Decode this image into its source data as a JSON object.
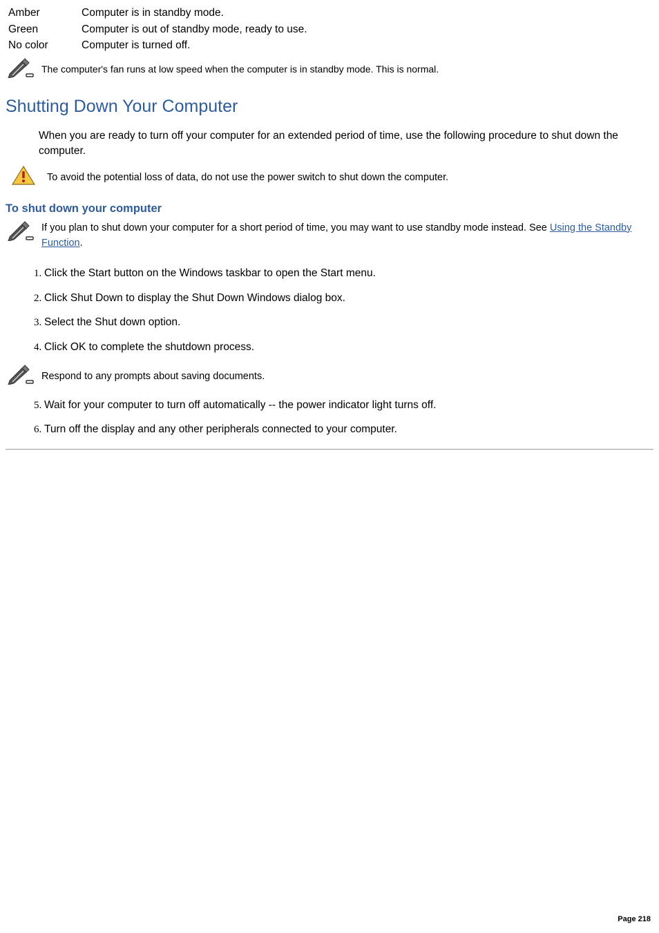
{
  "status_rows": [
    {
      "color": "Amber",
      "desc": "Computer is in standby mode."
    },
    {
      "color": "Green",
      "desc": "Computer is out of standby mode, ready to use."
    },
    {
      "color": "No color",
      "desc": "Computer is turned off."
    }
  ],
  "fan_note": "The computer's fan runs at low speed when the computer is in standby mode. This is normal.",
  "section_heading": "Shutting Down Your Computer",
  "intro": "When you are ready to turn off your computer for an extended period of time, use the following procedure to shut down the computer.",
  "warning": "To avoid the potential loss of data, do not use the power switch to shut down the computer.",
  "sub_heading": "To shut down your computer",
  "standby_note_pre": "If you plan to shut down your computer for a short period of time, you may want to use standby mode instead. See ",
  "standby_link": "Using the Standby Function",
  "standby_note_post": ".",
  "steps_a": [
    "Click the Start button on the Windows   taskbar to open the Start menu.",
    "Click Shut Down to display the Shut Down Windows dialog box.",
    "Select the Shut down option.",
    "Click OK to complete the shutdown process."
  ],
  "respond_note": "Respond to any prompts about saving documents.",
  "steps_b": [
    "Wait for your computer to turn off automatically -- the power indicator light turns off.",
    "Turn off the display and any other peripherals connected to your computer."
  ],
  "page_number": "Page 218"
}
